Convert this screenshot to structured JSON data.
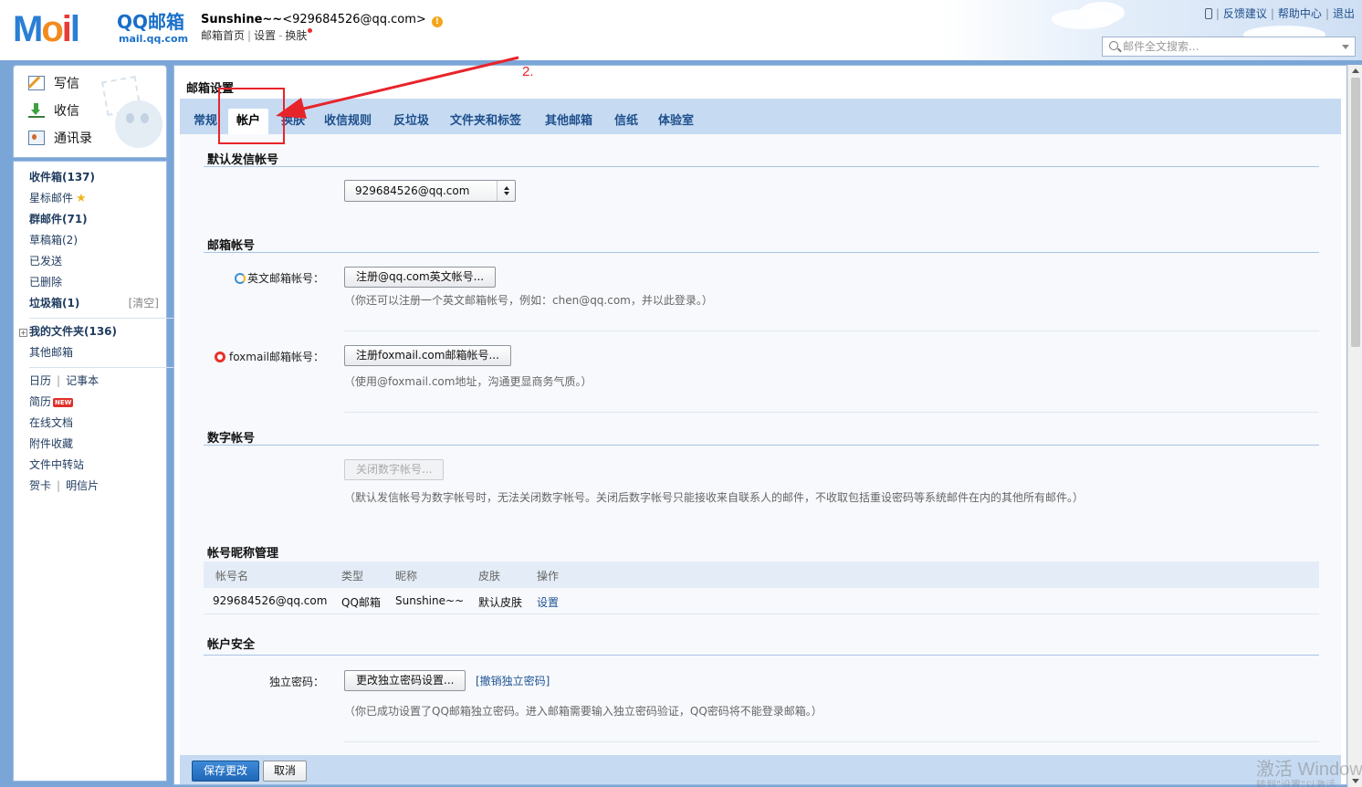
{
  "header": {
    "logo_text": "Mail",
    "logo_qq": "QQ邮箱",
    "logo_url": "mail.qq.com",
    "user_name": "Sunshine~~",
    "user_email": "<929684526@qq.com>",
    "warn_symbol": "!",
    "links": {
      "home": "邮箱首页",
      "settings": "设置",
      "skin": "换肤"
    },
    "top_right": {
      "feedback": "反馈建议",
      "help": "帮助中心",
      "logout": "退出"
    },
    "search_placeholder": "邮件全文搜索..."
  },
  "sidebar": {
    "actions": {
      "write": "写信",
      "receive": "收信",
      "contacts": "通讯录"
    },
    "folders": {
      "inbox": "收件箱(137)",
      "starred": "星标邮件",
      "group": "群邮件(71)",
      "drafts": "草稿箱(2)",
      "sent": "已发送",
      "deleted": "已删除",
      "spam": "垃圾箱(1)",
      "clear": "[清空]",
      "my_folders": "我的文件夹(136)",
      "other_mail": "其他邮箱",
      "calendar": "日历",
      "notes": "记事本",
      "resume": "简历",
      "new_badge": "NEW",
      "docs": "在线文档",
      "attachments": "附件收藏",
      "transfer": "文件中转站",
      "cards": "贺卡",
      "postcards": "明信片"
    }
  },
  "main": {
    "title": "邮箱设置",
    "tabs": [
      "常规",
      "帐户",
      "换肤",
      "收信规则",
      "反垃圾",
      "文件夹和标签",
      "其他邮箱",
      "信纸",
      "体验室"
    ],
    "active_tab": "帐户",
    "default_sender": {
      "title": "默认发信帐号",
      "selected": "929684526@qq.com"
    },
    "mail_accounts": {
      "title": "邮箱帐号",
      "english_label": "英文邮箱帐号：",
      "english_button": "注册@qq.com英文帐号...",
      "english_hint": "（你还可以注册一个英文邮箱帐号，例如：chen@qq.com，并以此登录。）",
      "foxmail_label": "foxmail邮箱帐号：",
      "foxmail_button": "注册foxmail.com邮箱帐号...",
      "foxmail_hint": "（使用@foxmail.com地址，沟通更显商务气质。）"
    },
    "numeric_account": {
      "title": "数字帐号",
      "button": "关闭数字帐号...",
      "hint": "（默认发信帐号为数字帐号时，无法关闭数字帐号。关闭后数字帐号只能接收来自联系人的邮件，不收取包括重设密码等系统邮件在内的其他所有邮件。）"
    },
    "nickname": {
      "title": "帐号昵称管理",
      "headers": [
        "帐号名",
        "类型",
        "昵称",
        "皮肤",
        "操作"
      ],
      "row": [
        "929684526@qq.com",
        "QQ邮箱",
        "Sunshine~~",
        "默认皮肤",
        "设置"
      ]
    },
    "security": {
      "title": "帐户安全",
      "label": "独立密码：",
      "button": "更改独立密码设置...",
      "revoke": "[撤销独立密码]",
      "hint": "（你已成功设置了QQ邮箱独立密码。进入邮箱需要输入独立密码验证，QQ密码将不能登录邮箱。）"
    },
    "footer": {
      "save": "保存更改",
      "cancel": "取消"
    }
  },
  "annotation": {
    "label": "2.",
    "color": "#e8242b"
  },
  "watermark": {
    "line1": "激活 Windows",
    "line2": "转到\"设置\"以激活"
  }
}
